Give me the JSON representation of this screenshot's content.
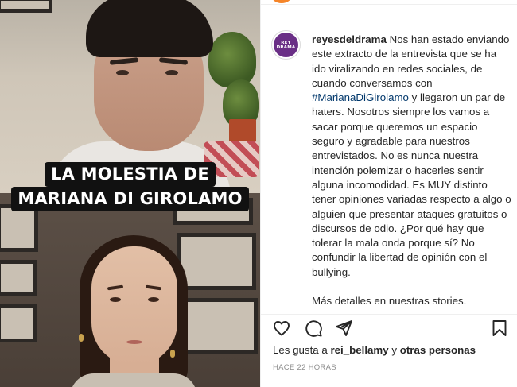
{
  "video": {
    "caption_line1": "LA MOLESTIA DE",
    "caption_line2": "MARIANA DI GIROLAMO"
  },
  "post": {
    "avatar_text_top": "REY",
    "avatar_text_bottom": "DRAMA",
    "username": "reyesdeldrama",
    "caption_before_tag": "Nos han estado enviando este extracto de la entrevista que se ha ido viralizando en redes sociales, de cuando conversamos con",
    "hashtag": "#MarianaDiGirolamo",
    "caption_after_tag": "y llegaron un par de haters. Nosotros siempre los vamos a sacar porque queremos un espacio seguro y agradable para nuestros entrevistados. No es nunca nuestra intención polemizar o hacerles sentir alguna incomodidad. Es MUY distinto tener opiniones variadas respecto a algo o alguien que presentar ataques gratuitos o discursos de odio. ¿Por qué hay que tolerar la mala onda porque sí? No confundir la libertad de opinión con el bullying.",
    "more_details": "Más detalles en nuestras stories."
  },
  "actions": {
    "like_icon": "heart-icon",
    "comment_icon": "comment-icon",
    "share_icon": "paper-plane-icon",
    "save_icon": "bookmark-icon"
  },
  "likes": {
    "prefix": "Les gusta a",
    "user": "rei_bellamy",
    "joiner": "y",
    "others": "otras personas"
  },
  "timestamp": "HACE 22 HORAS",
  "colors": {
    "hashtag": "#00376b",
    "brand_avatar": "#6a2f86",
    "muted": "#8e8e8e"
  }
}
